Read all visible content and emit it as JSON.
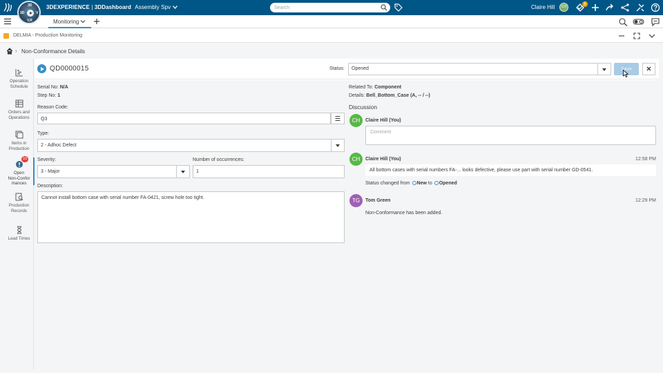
{
  "topbar": {
    "brand_bold": "3DEXPERIENCE",
    "brand_sep": " | ",
    "brand_app": "3DDashboard",
    "brand_space": "Assembly Spv",
    "search_placeholder": "Search",
    "user_name": "Claire Hill",
    "user_initials": "CH",
    "notif_count": "8",
    "compass_labels": {
      "top": "3D",
      "left": "3D",
      "right": "V",
      "bottom": "V,R"
    }
  },
  "tabbar": {
    "active_tab": "Monitoring"
  },
  "appbar": {
    "title": "DELMIA - Production Monitoring"
  },
  "breadcrumb": {
    "current": "Non-Conformance Details",
    "separator": "›"
  },
  "sidebar": {
    "items": [
      {
        "label_1": "Operation",
        "label_2": "Schedule"
      },
      {
        "label_1": "Orders and",
        "label_2": "Operations"
      },
      {
        "label_1": "Items in",
        "label_2": "Production"
      },
      {
        "label_1": "Open",
        "label_2": "Non-Confor",
        "label_3": "mances",
        "badge": "10"
      },
      {
        "label_1": "Production",
        "label_2": "Records"
      },
      {
        "label_1": "Lead Times"
      }
    ]
  },
  "header": {
    "nc_id": "QD0000015",
    "status_label": "Status:",
    "status_value": "Opened",
    "save_label": "Save",
    "close_label": "✕"
  },
  "details": {
    "serial_label": "Serial No:",
    "serial_value": "N/A",
    "step_label": "Step No:",
    "step_value": "1",
    "reason_label": "Reason Code:",
    "reason_value": "Q3",
    "type_label": "Type:",
    "type_value": "2 - Adhoc Defect",
    "severity_label": "Severity:",
    "severity_value": "3 - Major",
    "occurrences_label": "Number of occurrences:",
    "occurrences_value": "1",
    "description_label": "Description:",
    "description_value": "Cannot install bottom case with serial number FA-0421, screw hole too tight."
  },
  "related": {
    "related_label": "Related To:",
    "related_value": "Component",
    "details_label": "Details:",
    "details_value": "Bell_Bottom_Case (A, -- / --)"
  },
  "discussion": {
    "title": "Discussion",
    "comment_placeholder": "Comment",
    "current_user": {
      "initials": "CH",
      "name": "Claire Hill (You)"
    },
    "entries": [
      {
        "initials": "CH",
        "name": "Claire Hill (You)",
        "time": "12:58 PM",
        "message": "All bottom cases with serial numbers FA-... looks defective, please use part with serial number GD-0541.",
        "status_prefix": "Status changed from",
        "status_from": "New",
        "status_mid": "to",
        "status_to": "Opened"
      },
      {
        "initials": "TG",
        "name": "Tom Green",
        "time": "12:29 PM",
        "message": "Non-Conformance has been added."
      }
    ]
  }
}
